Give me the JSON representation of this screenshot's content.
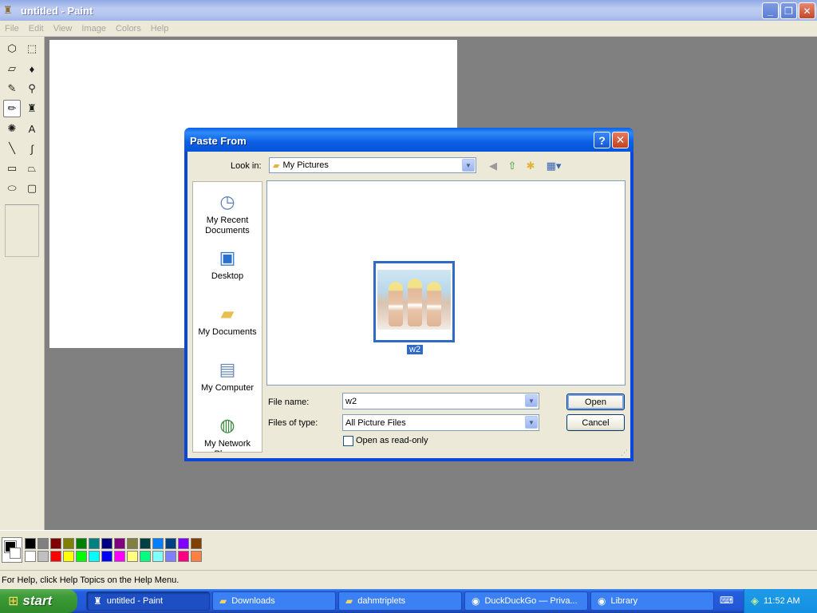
{
  "window": {
    "title": "untitled - Paint",
    "controls": {
      "minimize": "_",
      "maximize": "❐",
      "close": "✕"
    }
  },
  "menu": [
    "File",
    "Edit",
    "View",
    "Image",
    "Colors",
    "Help"
  ],
  "tools": [
    {
      "name": "free-form-select",
      "glyph": "⬡"
    },
    {
      "name": "select",
      "glyph": "⬚"
    },
    {
      "name": "eraser",
      "glyph": "▱"
    },
    {
      "name": "fill-with-color",
      "glyph": "♦"
    },
    {
      "name": "pick-color",
      "glyph": "✎"
    },
    {
      "name": "magnifier",
      "glyph": "⚲"
    },
    {
      "name": "pencil",
      "glyph": "✏"
    },
    {
      "name": "brush",
      "glyph": "♜"
    },
    {
      "name": "airbrush",
      "glyph": "✺"
    },
    {
      "name": "text",
      "glyph": "A"
    },
    {
      "name": "line",
      "glyph": "╲"
    },
    {
      "name": "curve",
      "glyph": "∫"
    },
    {
      "name": "rectangle",
      "glyph": "▭"
    },
    {
      "name": "polygon",
      "glyph": "⏢"
    },
    {
      "name": "ellipse",
      "glyph": "⬭"
    },
    {
      "name": "rounded-rectangle",
      "glyph": "▢"
    }
  ],
  "palette": {
    "top": [
      "#000000",
      "#808080",
      "#800000",
      "#808000",
      "#008000",
      "#008080",
      "#000080",
      "#800080",
      "#808040",
      "#004040",
      "#0080ff",
      "#004080",
      "#8000ff",
      "#804000"
    ],
    "bottom": [
      "#ffffff",
      "#c0c0c0",
      "#ff0000",
      "#ffff00",
      "#00ff00",
      "#00ffff",
      "#0000ff",
      "#ff00ff",
      "#ffff80",
      "#00ff80",
      "#80ffff",
      "#8080ff",
      "#ff0080",
      "#ff8040"
    ]
  },
  "status": "For Help, click Help Topics on the Help Menu.",
  "dialog": {
    "title": "Paste From",
    "help": "?",
    "close": "✕",
    "look_in_label": "Look in:",
    "look_in_value": "My Pictures",
    "places": [
      "My Recent Documents",
      "Desktop",
      "My Documents",
      "My Computer",
      "My Network Places"
    ],
    "files": [
      {
        "name": "w2"
      }
    ],
    "file_name_label": "File name:",
    "file_name_value": "w2",
    "files_of_type_label": "Files of type:",
    "files_of_type_value": "All Picture Files",
    "read_only_label": "Open as read-only",
    "open_label": "Open",
    "cancel_label": "Cancel"
  },
  "taskbar": {
    "start": "start",
    "tasks": [
      {
        "label": "untitled - Paint",
        "icon": "paint-icon"
      },
      {
        "label": "Downloads",
        "icon": "folder-icon"
      },
      {
        "label": "dahmtriplets",
        "icon": "folder-icon"
      },
      {
        "label": "DuckDuckGo — Priva...",
        "icon": "firefox-icon"
      },
      {
        "label": "Library",
        "icon": "firefox-icon"
      }
    ],
    "clock": "11:52 AM"
  }
}
